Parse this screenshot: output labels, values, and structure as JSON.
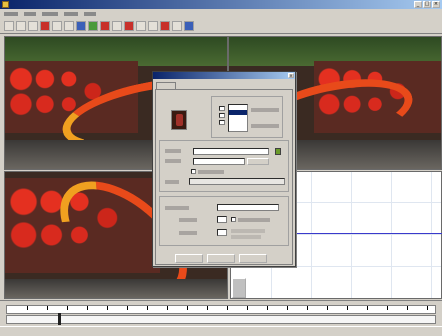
{
  "window": {
    "title": ""
  },
  "menu": [],
  "dialog": {
    "title": "",
    "tab_label": "",
    "group_1": "",
    "group_2": "",
    "group_3": "",
    "buttons": [
      "",
      "",
      ""
    ]
  },
  "colors": {
    "titlebar": "#0a246a",
    "graph_line": "#3a3acc",
    "chrome": "#d4d0c8"
  },
  "icons": [
    "minimize-icon",
    "maximize-icon",
    "close-icon",
    "swatch-icon",
    "color-picker-icon"
  ]
}
